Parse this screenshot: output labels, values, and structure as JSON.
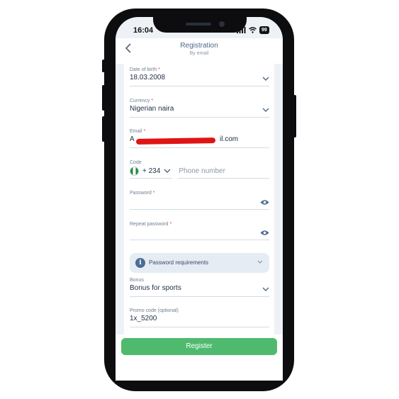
{
  "status_bar": {
    "time": "16:04",
    "battery": "99"
  },
  "header": {
    "title": "Registration",
    "subtitle": "By email"
  },
  "fields": {
    "dob": {
      "label": "Date of birth",
      "required": "*",
      "value": "18.03.2008"
    },
    "currency": {
      "label": "Currency",
      "required": "*",
      "value": "Nigerian naira"
    },
    "email": {
      "label": "Email",
      "required": "*",
      "value_start": "A",
      "value_end": "il.com"
    },
    "phone": {
      "label": "Code",
      "code": "+ 234",
      "placeholder": "Phone number"
    },
    "password": {
      "label": "Password",
      "required": "*"
    },
    "repeat_password": {
      "label": "Repeat password",
      "required": "*"
    },
    "requirements": {
      "label": "Password requirements"
    },
    "bonus": {
      "label": "Bonus",
      "value": "Bonus for sports"
    },
    "promo": {
      "label": "Promo code (optional)",
      "value": "1x_5200"
    }
  },
  "register_button": {
    "label": "Register"
  },
  "colors": {
    "accent": "#4fba6e",
    "required": "#e04545",
    "redaction": "#e01414"
  }
}
